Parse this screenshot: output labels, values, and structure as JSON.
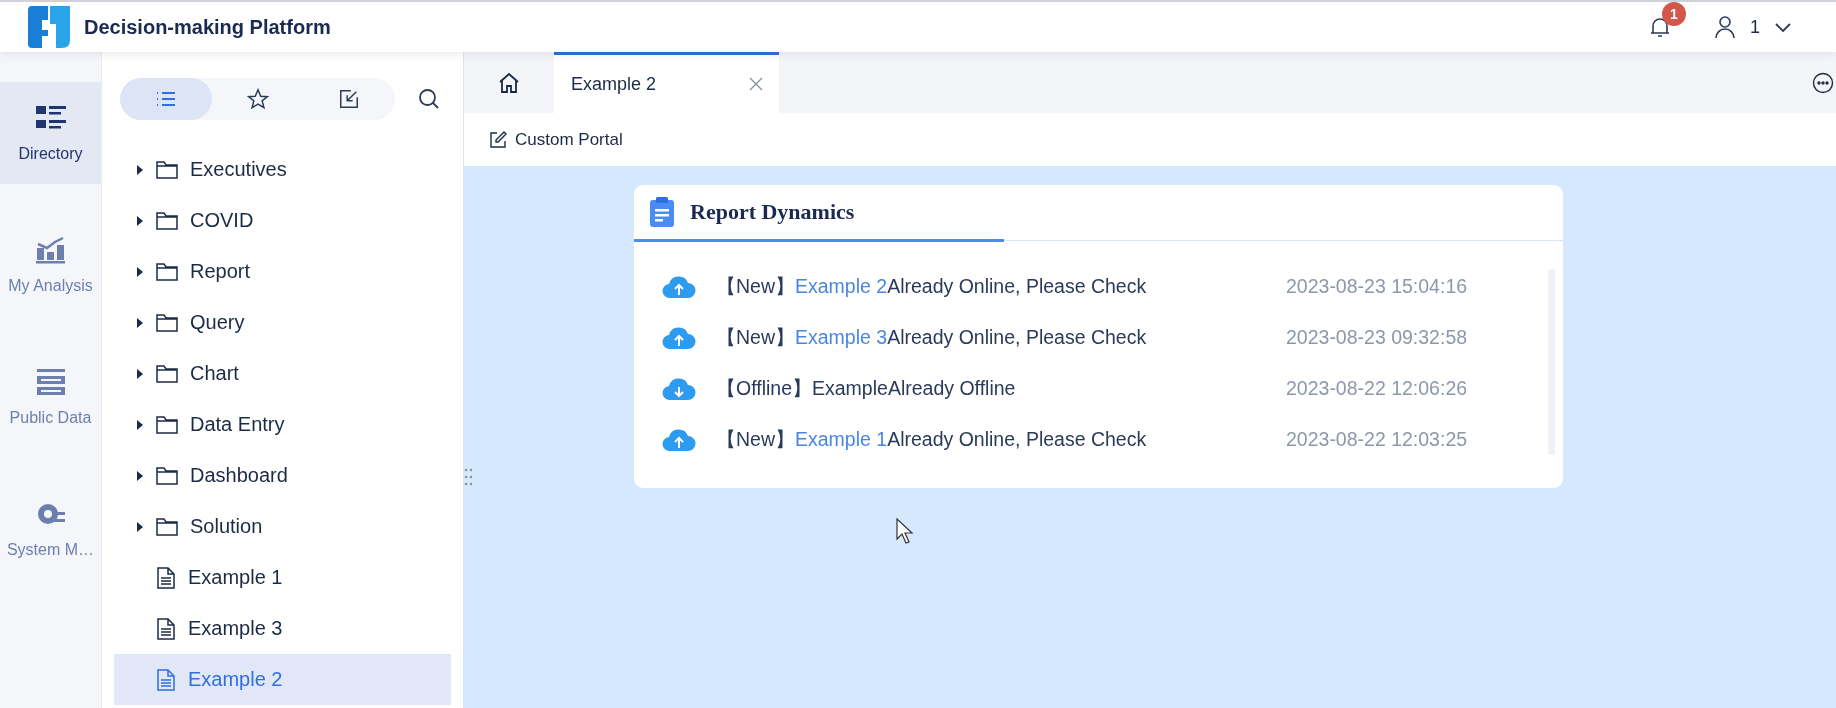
{
  "header": {
    "title": "Decision-making Platform",
    "notification_count": "1",
    "user": "1"
  },
  "nav": [
    {
      "kind": "directory",
      "label": "Directory",
      "selected": true
    },
    {
      "kind": "analysis",
      "label": "My Analysis",
      "selected": false
    },
    {
      "kind": "public",
      "label": "Public Data",
      "selected": false
    },
    {
      "kind": "system",
      "label": "System M…",
      "selected": false
    }
  ],
  "sidebar": {
    "view_tabs": [
      {
        "kind": "list",
        "selected": true
      },
      {
        "kind": "star",
        "selected": false
      },
      {
        "kind": "import",
        "selected": false
      }
    ],
    "tree": [
      {
        "kind": "folder",
        "label": "Executives",
        "selected": false
      },
      {
        "kind": "folder",
        "label": "COVID",
        "selected": false
      },
      {
        "kind": "folder",
        "label": "Report",
        "selected": false
      },
      {
        "kind": "folder",
        "label": "Query",
        "selected": false
      },
      {
        "kind": "folder",
        "label": "Chart",
        "selected": false
      },
      {
        "kind": "folder",
        "label": "Data Entry",
        "selected": false
      },
      {
        "kind": "folder",
        "label": "Dashboard",
        "selected": false
      },
      {
        "kind": "folder",
        "label": "Solution",
        "selected": false
      },
      {
        "kind": "file",
        "label": "Example 1",
        "selected": false
      },
      {
        "kind": "file",
        "label": "Example 3",
        "selected": false
      },
      {
        "kind": "file",
        "label": "Example 2",
        "selected": true
      }
    ]
  },
  "tabs": [
    {
      "label": "Example 2",
      "selected": true
    }
  ],
  "toolbar": {
    "action": "Custom Portal"
  },
  "card": {
    "title": "Report Dynamics",
    "entries": [
      {
        "kind": "online",
        "prefix": "【New】",
        "link": "Example 2",
        "rest": "Already Online, Please Check",
        "time": "2023-08-23 15:04:16"
      },
      {
        "kind": "online",
        "prefix": "【New】",
        "link": "Example 3",
        "rest": "Already Online, Please Check",
        "time": "2023-08-23 09:32:58"
      },
      {
        "kind": "offline",
        "prefix": "【Offline】",
        "rest": "ExampleAlready Offline",
        "time": "2023-08-22 12:06:26"
      },
      {
        "kind": "online",
        "prefix": "【New】",
        "link": "Example 1",
        "rest": "Already Online, Please Check",
        "time": "2023-08-22 12:03:25"
      }
    ]
  }
}
